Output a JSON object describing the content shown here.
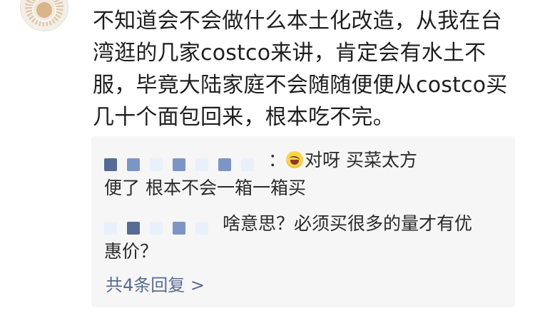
{
  "comment": {
    "text": "不知道会不会做什么本土化改造，从我在台湾逛的几家costco来讲，肯定会有水土不服，毕竟大陆家庭不会随随便便从costco买几十个面包回来，根本吃不完。"
  },
  "replies": [
    {
      "text_line1": "对呀 买菜太方",
      "text_line2": "便了 根本不会一箱一箱买",
      "emoji": "laughing-crying-emoji"
    },
    {
      "text_line1": "啥意思？必须买很多的量才有优",
      "text_line2": "惠价？"
    }
  ],
  "more_replies": {
    "label": "共4条回复 >"
  },
  "colors": {
    "link": "#576b95",
    "reply_bg": "#f6f6f6",
    "text": "#1f1f1f"
  }
}
